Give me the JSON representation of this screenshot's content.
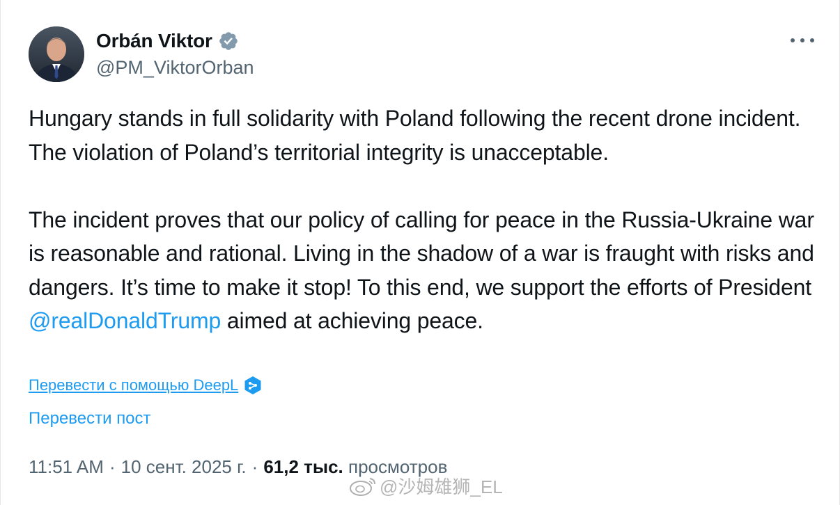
{
  "author": {
    "name": "Orbán Viktor",
    "handle": "@PM_ViktorOrban",
    "verified_color": "#829aab"
  },
  "tweet": {
    "paragraph1": "Hungary stands in full solidarity with Poland following the recent drone incident. The violation of Poland’s territorial integrity is unacceptable.",
    "paragraph2_before": "The incident proves that our policy of calling for peace in the Russia-Ukraine war is reasonable and rational. Living in the shadow of a war is fraught with risks and dangers. It’s time to make it stop! To this end, we support the efforts of President ",
    "mention": "@realDonaldTrump",
    "paragraph2_after": " aimed at achieving peace."
  },
  "translate": {
    "deepl_label": "Перевести с помощью DeepL",
    "post_label": "Перевести пост"
  },
  "meta": {
    "time": "11:51 AM",
    "separator": "·",
    "date": "10 сент. 2025 г.",
    "views_count": "61,2 тыс.",
    "views_label": "просмотров"
  },
  "watermark": {
    "text": "@沙姆雄狮_EL"
  },
  "colors": {
    "accent": "#1d9bf0",
    "text": "#0f1419",
    "secondary": "#536471"
  },
  "icons": [
    "avatar-photo",
    "verified-badge-icon",
    "more-options-icon",
    "deepl-icon",
    "weibo-logo"
  ]
}
